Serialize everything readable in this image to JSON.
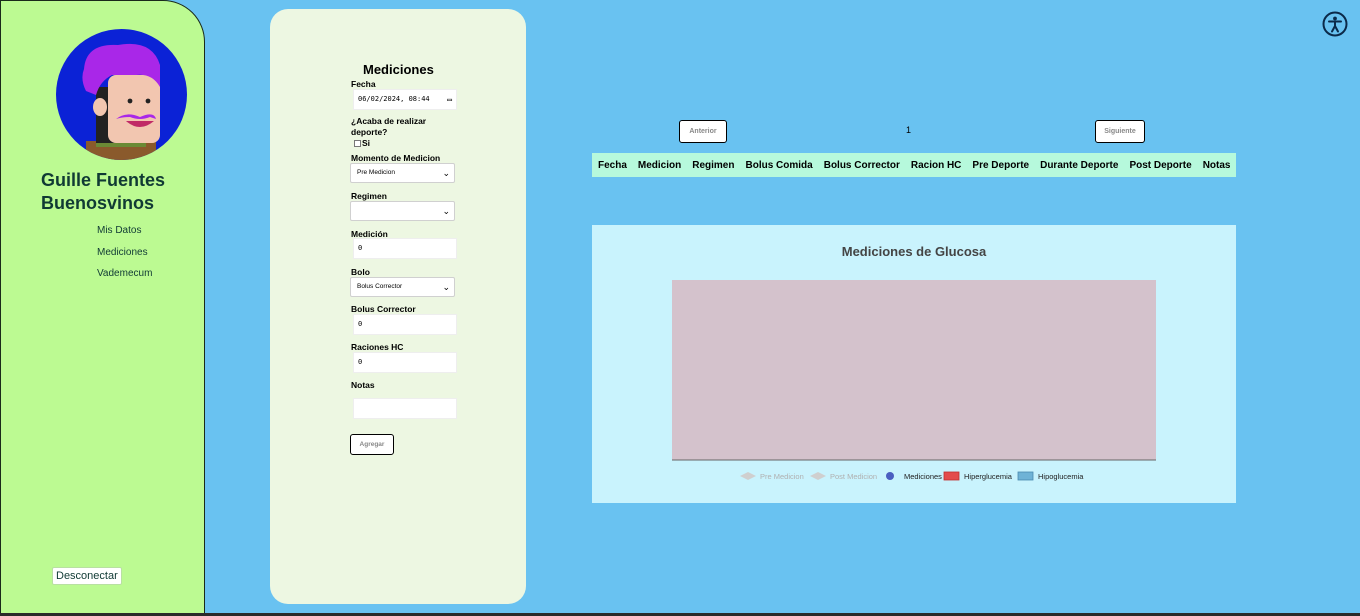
{
  "sidebar": {
    "user_name": "Guille Fuentes Buenosvinos",
    "nav": [
      {
        "label": "Mis Datos"
      },
      {
        "label": "Mediciones"
      },
      {
        "label": "Vademecum"
      }
    ],
    "logout_label": "Desconectar"
  },
  "form": {
    "title": "Mediciones",
    "fecha_label": "Fecha",
    "fecha_value": "06/02/2024, 08:44",
    "deporte_label": "¿Acaba de realizar deporte?",
    "deporte_option": "Si",
    "momento_label": "Momento de Medicion",
    "momento_value": "Pre Medicion",
    "regimen_label": "Regimen",
    "regimen_value": "",
    "medicion_label": "Medición",
    "medicion_value": "0",
    "bolo_label": "Bolo",
    "bolo_value": "Bolus Corrector",
    "bolus_corrector_label": "Bolus Corrector",
    "bolus_corrector_value": "0",
    "raciones_label": "Raciones HC",
    "raciones_value": "0",
    "notas_label": "Notas",
    "notas_value": "",
    "submit_label": "Agregar"
  },
  "pager": {
    "prev_label": "Anterior",
    "page": "1",
    "next_label": "Siguiente"
  },
  "table": {
    "columns": [
      "Fecha",
      "Medicion",
      "Regimen",
      "Bolus Comida",
      "Bolus Corrector",
      "Racion HC",
      "Pre Deporte",
      "Durante Deporte",
      "Post Deporte",
      "Notas"
    ],
    "rows": []
  },
  "chart_data": {
    "type": "line",
    "title": "Mediciones de Glucosa",
    "series": [
      {
        "name": "Pre Medicion",
        "values": [],
        "hidden": true
      },
      {
        "name": "Post Medicion",
        "values": [],
        "hidden": true
      },
      {
        "name": "Mediciones",
        "values": []
      },
      {
        "name": "Hiperglucemia",
        "values": []
      },
      {
        "name": "Hipoglucemia",
        "values": []
      }
    ],
    "legend_position": "bottom",
    "colors": {
      "plot_area": "#d4c2cc",
      "mediciones": "#4b5fc0",
      "hiperglucemia": "#e34c4c",
      "hipoglucemia": "#6fb3d6",
      "hidden_legend": "#cfcfcf"
    }
  },
  "colors": {
    "background": "#69c2f1",
    "sidebar": "#bcfa92",
    "form_panel": "#edf7e2",
    "table_header": "#b6f9dc",
    "chart_panel": "#c9f3fd"
  }
}
